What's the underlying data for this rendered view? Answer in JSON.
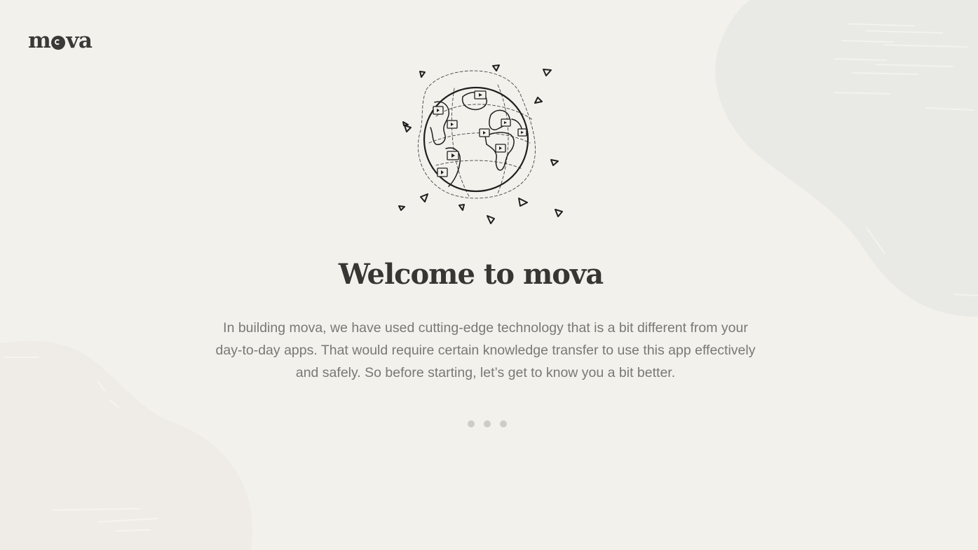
{
  "brand": {
    "logo_text_start": "m",
    "logo_text_end": "va"
  },
  "welcome": {
    "title": "Welcome to mova",
    "description": "In building mova, we have used cutting-edge technology that is a bit different from your day-to-day apps. That would require certain knowledge transfer to use this app effectively and safely. So before starting, let’s get to  know you a bit better."
  },
  "pagination": {
    "total": 3,
    "active": 1
  },
  "colors": {
    "background": "#f3f1ec",
    "text_dark": "#373633",
    "text_muted": "#7a7875",
    "dot": "#cfccc7",
    "blob_right": "#e9eae6",
    "blob_left": "#efece7"
  },
  "icons": {
    "illustration": "globe-with-paper-planes"
  }
}
